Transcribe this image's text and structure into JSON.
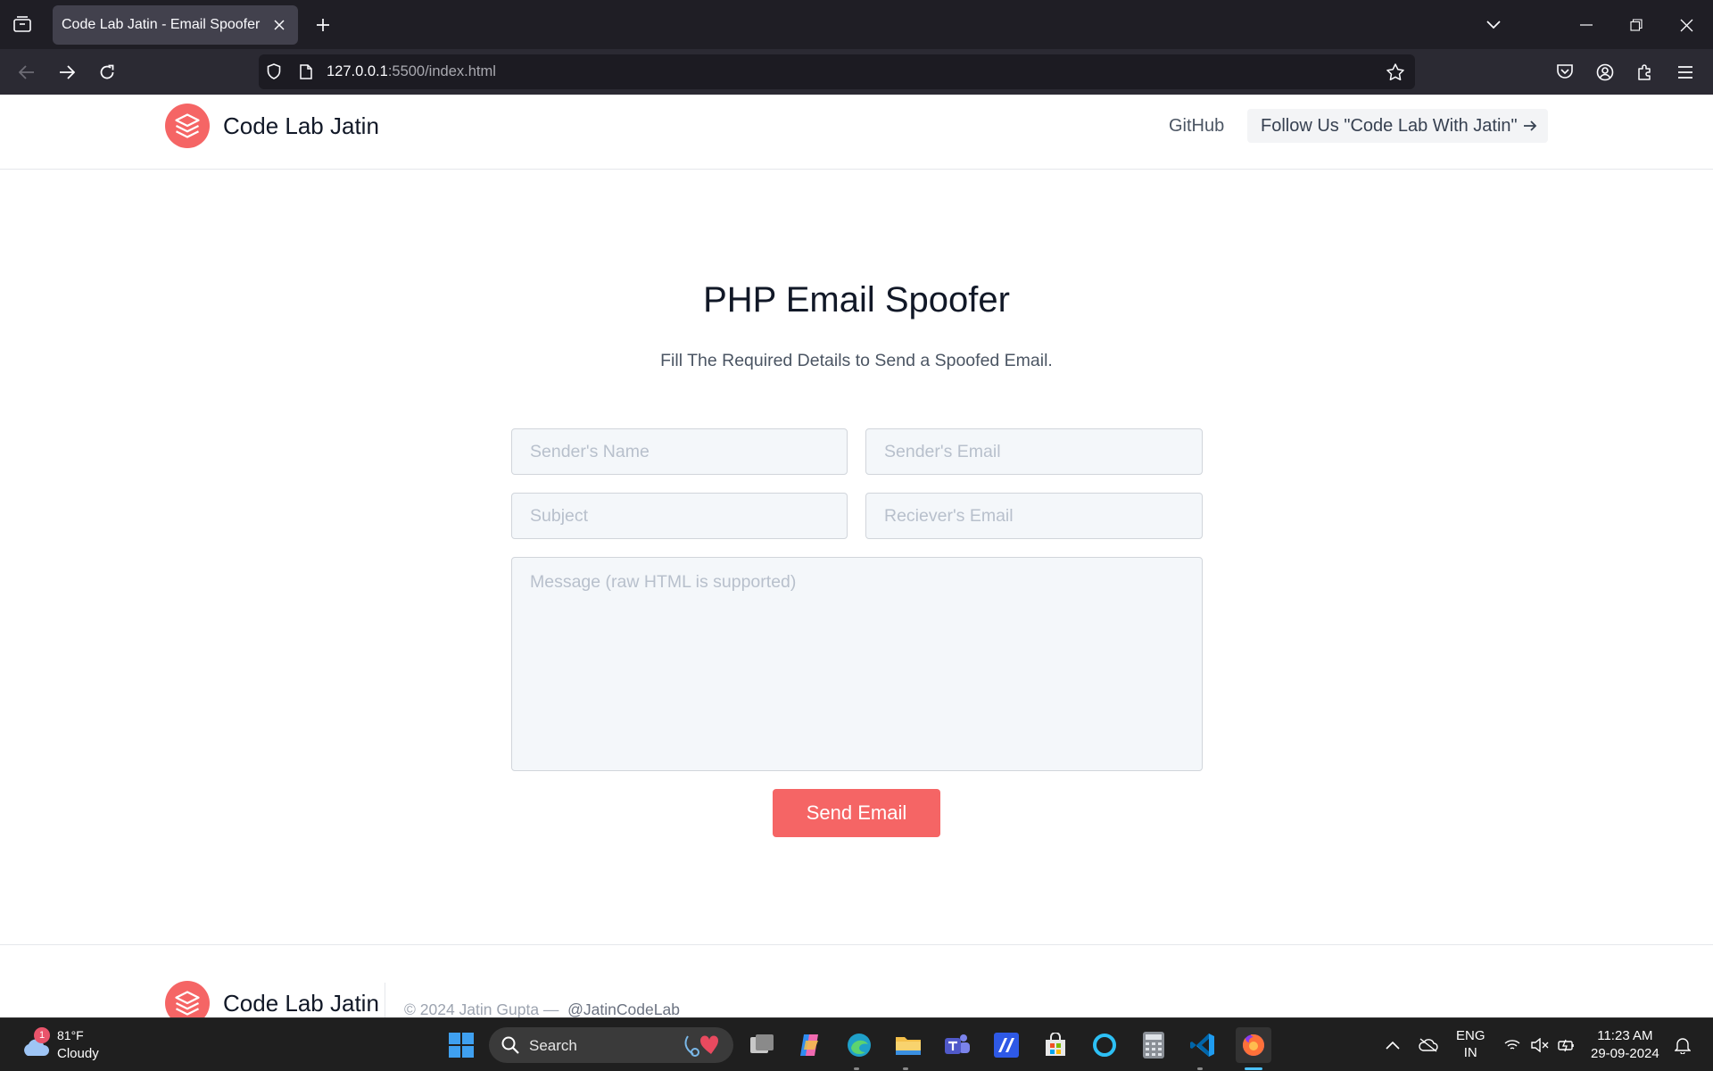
{
  "browser": {
    "tab_title": "Code Lab Jatin - Email Spoofer",
    "url_host": "127.0.0.1",
    "url_rest": ":5500/index.html"
  },
  "site": {
    "brand": "Code Lab Jatin",
    "nav_github": "GitHub",
    "follow_label": "Follow Us \"Code Lab With Jatin\""
  },
  "hero": {
    "title": "PHP Email Spoofer",
    "subtitle": "Fill The Required Details to Send a Spoofed Email."
  },
  "form": {
    "sender_name_placeholder": "Sender's Name",
    "sender_email_placeholder": "Sender's Email",
    "subject_placeholder": "Subject",
    "receiver_email_placeholder": "Reciever's Email",
    "message_placeholder": "Message (raw HTML is supported)",
    "submit_label": "Send Email"
  },
  "footer": {
    "brand": "Code Lab Jatin",
    "copyright": "© 2024 Jatin Gupta —",
    "handle": "@JatinCodeLab"
  },
  "taskbar": {
    "weather_temp": "81°F",
    "weather_cond": "Cloudy",
    "weather_badge": "1",
    "search_label": "Search",
    "lang_line1": "ENG",
    "lang_line2": "IN",
    "time": "11:23 AM",
    "date": "29-09-2024"
  },
  "colors": {
    "accent": "#f56565",
    "chrome_dark": "#1f1e25",
    "taskbar": "#1f1f1f"
  }
}
